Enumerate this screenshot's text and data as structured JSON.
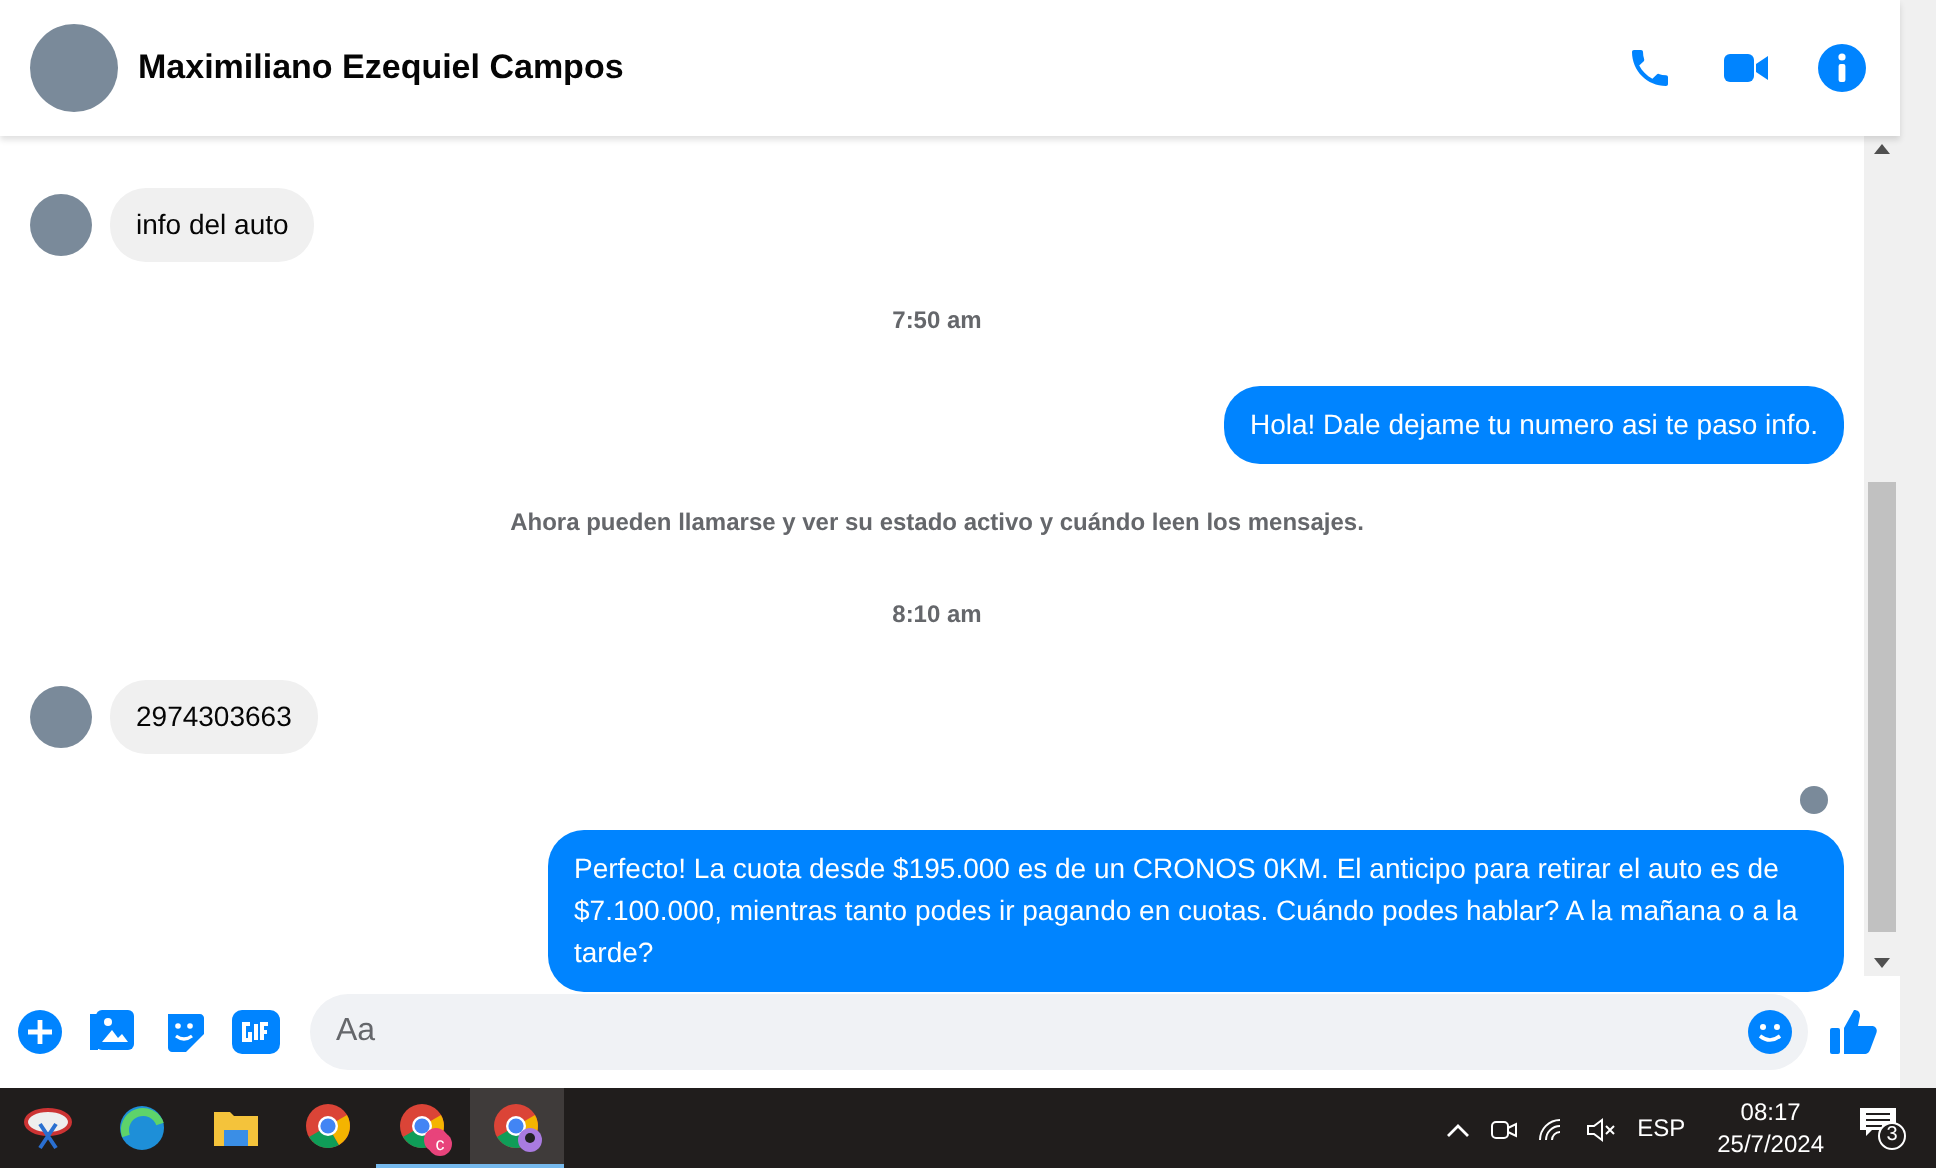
{
  "header": {
    "name": "Maximiliano Ezequiel Campos"
  },
  "messages": [
    {
      "kind": "incoming",
      "text": "info del auto"
    },
    {
      "kind": "timestamp",
      "text": "7:50 am"
    },
    {
      "kind": "outgoing",
      "text": "Hola! Dale dejame tu numero  asi te paso info."
    },
    {
      "kind": "notice",
      "text": "Ahora pueden llamarse y ver su estado activo y cuándo leen los mensajes."
    },
    {
      "kind": "timestamp",
      "text": "8:10 am"
    },
    {
      "kind": "incoming",
      "text": "2974303663"
    },
    {
      "kind": "seen"
    },
    {
      "kind": "outgoing",
      "text": "Perfecto! La cuota desde $195.000 es de un CRONOS 0KM. El anticipo para retirar el auto es de $7.100.000, mientras tanto podes ir pagando en cuotas. Cuándo podes hablar? A la mañana o a la tarde?"
    }
  ],
  "composer": {
    "placeholder": "Aa"
  },
  "taskbar": {
    "apps": [
      {
        "kind": "snip",
        "selected": false,
        "running": false
      },
      {
        "kind": "edge",
        "selected": false,
        "running": false
      },
      {
        "kind": "folder",
        "selected": false,
        "running": false
      },
      {
        "kind": "chrome",
        "selected": false,
        "running": false
      },
      {
        "kind": "chrome-c",
        "badge": "c",
        "selected": false,
        "running": true
      },
      {
        "kind": "chrome-p",
        "selected": true,
        "running": true
      }
    ],
    "language": "ESP",
    "time": "08:17",
    "date": "25/7/2024",
    "notifications": "3"
  }
}
